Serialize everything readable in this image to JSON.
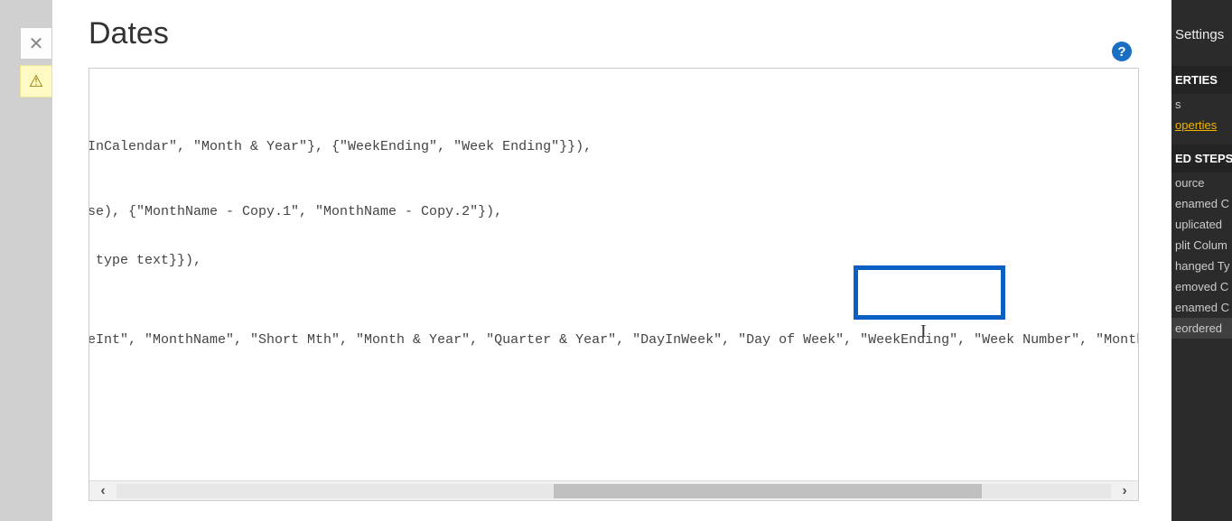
{
  "page_title": "Dates",
  "close_label": "✕",
  "warning_symbol": "⚠",
  "help_symbol": "?",
  "code": {
    "line1": "InCalendar\", \"Month & Year\"}, {\"WeekEnding\", \"Week Ending\"}}),",
    "line2": "se), {\"MonthName - Copy.1\", \"MonthName - Copy.2\"}),",
    "line3": " type text}}),",
    "line4": "eInt\", \"MonthName\", \"Short Mth\", \"Month & Year\", \"Quarter & Year\", \"DayInWeek\", \"Day of Week\", \"WeekEnding\", \"Week Number\", \"MonthnYear\", \"Quar"
  },
  "right_panel": {
    "settings": "Settings",
    "properties_header": "ERTIES",
    "name_label": "s",
    "all_properties": "operties",
    "steps_header": "ED STEPS",
    "steps": [
      "ource",
      "enamed C",
      "uplicated",
      "plit Colum",
      "hanged Ty",
      "emoved C",
      "enamed C",
      "eordered "
    ]
  },
  "scroll": {
    "left": "‹",
    "right": "›"
  }
}
